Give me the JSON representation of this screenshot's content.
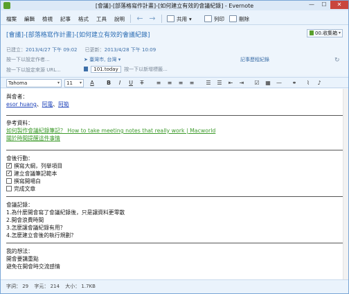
{
  "window": {
    "title": "[會議]-[部落格寫作計畫]-[如何建立有效的會議紀錄] - Evernote",
    "minimize": "—",
    "maximize": "☐",
    "close": "✕"
  },
  "menu": {
    "items": [
      "檔案",
      "編輯",
      "檢視",
      "記事",
      "格式",
      "工具",
      "說明"
    ]
  },
  "toolbar": {
    "share_label": "共用",
    "print_label": "列印",
    "delete_label": "刪除"
  },
  "note": {
    "title": "[會議]-[部落格寫作計畫]-[如何建立有效的會議紀錄]",
    "notebook": "00.收集箱",
    "created_label": "已建立：",
    "created_value": "2013/4/27 下午 09:02",
    "updated_label": "已更新：",
    "updated_value": "2013/4/28 下午 10:09",
    "author_placeholder": "按一下以設定作者...",
    "location": "臺灣市, 台灣",
    "reminder_link": "記事歷程紀錄",
    "url_placeholder": "按一下以設定來源 URL...",
    "tag": "101.today",
    "tag_placeholder": "按一下以新增標籤..."
  },
  "format": {
    "font": "Tahoma",
    "size": "11"
  },
  "content": {
    "attendees_heading": "與會者：",
    "attendees": [
      "esor huang",
      "阿電",
      "阿筍"
    ],
    "references_heading": "參考資料：",
    "ref_link1": "如何製作會議紀錄筆記？ How to take meeting notes that really work | Macworld",
    "ref_link2": "關於時間提醒這件事情",
    "actions_heading": "會後行動：",
    "actions": [
      {
        "label": "撰寫大綱，列舉項目",
        "checked": true
      },
      {
        "label": "建立會議筆記範本",
        "checked": true
      },
      {
        "label": "撰寫開場白",
        "checked": false
      },
      {
        "label": "完成文章",
        "checked": false
      }
    ],
    "records_heading": "會議記錄：",
    "records": [
      "1.為什麼開會寫了會議紀錄後，只是讓資料更零散",
      "2.開會浪費時間",
      "3.怎麼讓會議紀錄有用？",
      "4.怎麼建立會後的執行規劃？"
    ],
    "thoughts_heading": "我的想法：",
    "thoughts": [
      "開會要講重點",
      "避免在開會時交流感情"
    ]
  },
  "status": {
    "words": "字詞： 29",
    "chars": "字元： 214",
    "size": "大小： 1.7KB"
  }
}
